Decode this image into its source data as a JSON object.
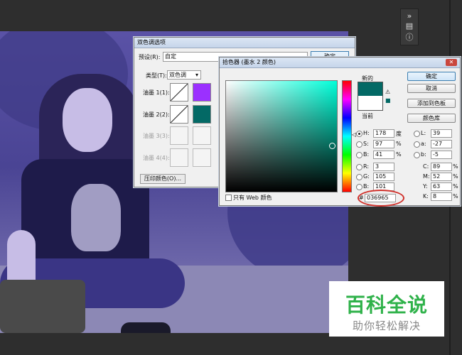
{
  "duotone": {
    "title": "双色调选项",
    "preset_label": "预设(R):",
    "preset_value": "自定",
    "ok_label": "确定",
    "type_label": "类型(T):",
    "type_value": "双色调",
    "ink1_label": "油墨 1(1):",
    "ink2_label": "油墨 2(2):",
    "ink3_label": "油墨 3(3):",
    "ink4_label": "油墨 4(4):",
    "ink1_color": "#9b30ff",
    "ink2_color": "#036965",
    "overprint_label": "压印颜色(O)..."
  },
  "picker": {
    "title": "拾色器 (墨水 2 颜色)",
    "new_label": "新的",
    "current_label": "当前",
    "ok_label": "确定",
    "cancel_label": "取消",
    "add_swatch_label": "添加到色板",
    "library_label": "颜色库",
    "web_only_label": "只有 Web 颜色",
    "hsb": [
      {
        "label": "H:",
        "value": "178",
        "unit": "度",
        "selected": true
      },
      {
        "label": "S:",
        "value": "97",
        "unit": "%",
        "selected": false
      },
      {
        "label": "B:",
        "value": "41",
        "unit": "%",
        "selected": false
      }
    ],
    "rgb": [
      {
        "label": "R:",
        "value": "3"
      },
      {
        "label": "G:",
        "value": "105"
      },
      {
        "label": "B:",
        "value": "101"
      }
    ],
    "lab": [
      {
        "label": "L:",
        "value": "39"
      },
      {
        "label": "a:",
        "value": "-27"
      },
      {
        "label": "b:",
        "value": "-5"
      }
    ],
    "cmyk": [
      {
        "label": "C:",
        "value": "89",
        "unit": "%"
      },
      {
        "label": "M:",
        "value": "52",
        "unit": "%"
      },
      {
        "label": "Y:",
        "value": "63",
        "unit": "%"
      },
      {
        "label": "K:",
        "value": "8",
        "unit": "%"
      }
    ],
    "hex_label": "#",
    "hex_value": "036965",
    "new_color": "#036965",
    "current_color": "#ffffff"
  },
  "watermark": {
    "main": "百科全说",
    "sub": "助你轻松解决"
  }
}
